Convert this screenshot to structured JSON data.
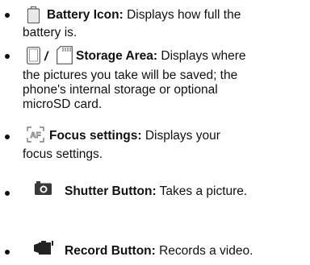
{
  "items": [
    {
      "title": "Battery Icon:",
      "text_first": "Displays how full the",
      "text_rest": [
        "battery is."
      ],
      "icon": "battery-icon"
    },
    {
      "separator": "/",
      "title": "Storage Area:",
      "text_first": "Displays where",
      "text_rest": [
        "the pictures you take will be saved; the",
        "phone's internal storage or optional",
        "microSD card."
      ],
      "icons": [
        "phone-storage-icon",
        "sd-card-icon"
      ]
    },
    {
      "title": "Focus settings:",
      "text_first": "Displays your",
      "text_rest": [
        "focus settings."
      ],
      "icon": "focus-af-icon"
    },
    {
      "title": "Shutter Button:",
      "text_first": "Takes a picture.",
      "icon": "camera-shutter-icon"
    },
    {
      "title": "Record Button:",
      "text_first": "Records a video.",
      "icon": "video-record-icon"
    }
  ]
}
